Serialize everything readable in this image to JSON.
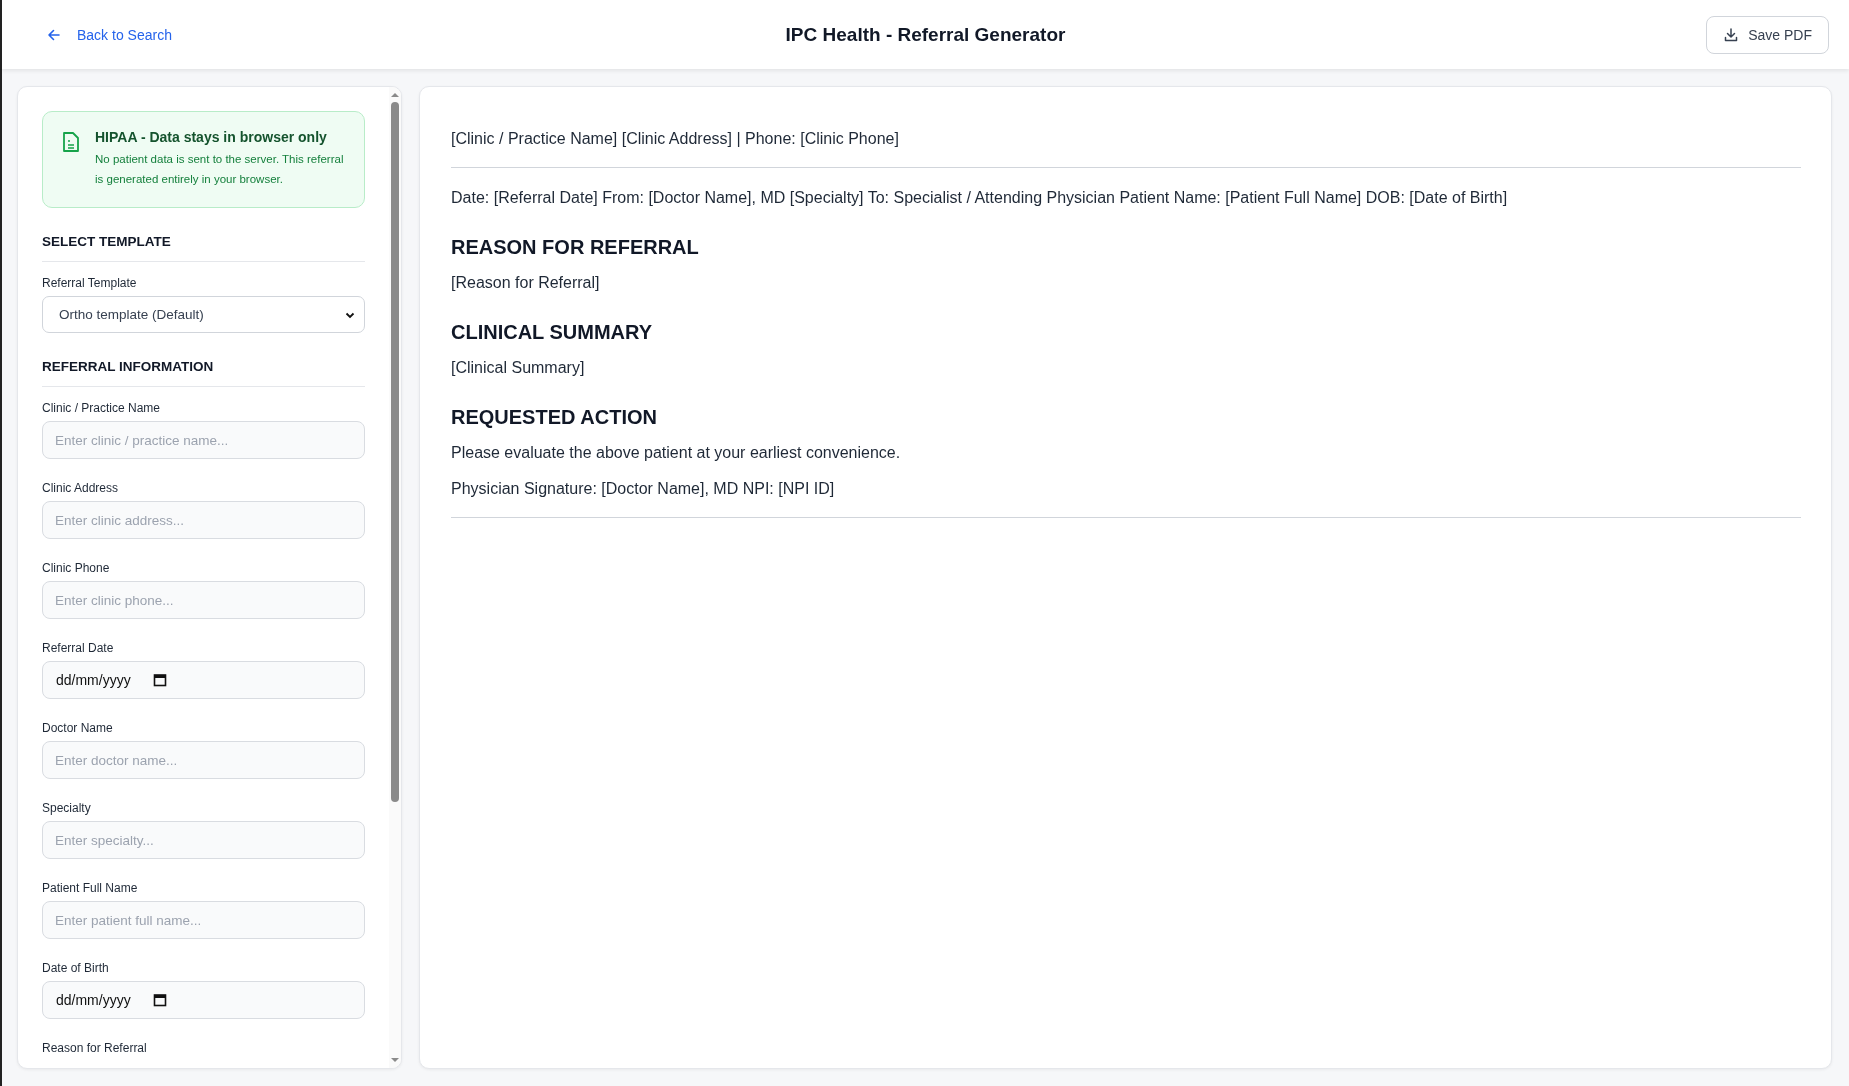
{
  "header": {
    "back_link": "Back to Search",
    "title": "IPC Health - Referral Generator",
    "save_button": "Save PDF"
  },
  "notice": {
    "title": "HIPAA - Data stays in browser only",
    "text": "No patient data is sent to the server. This referral is generated entirely in your browser."
  },
  "sections": [
    {
      "heading": "SELECT TEMPLATE",
      "fields": [
        {
          "kind": "select",
          "label": "Referral Template",
          "value": "Ortho template (Default)"
        }
      ]
    },
    {
      "heading": "REFERRAL INFORMATION",
      "fields": [
        {
          "kind": "text",
          "label": "Clinic / Practice Name",
          "placeholder": "Enter clinic / practice name..."
        },
        {
          "kind": "text",
          "label": "Clinic Address",
          "placeholder": "Enter clinic address..."
        },
        {
          "kind": "text",
          "label": "Clinic Phone",
          "placeholder": "Enter clinic phone..."
        },
        {
          "kind": "date",
          "label": "Referral Date",
          "value": "dd/mm/yyyy"
        },
        {
          "kind": "text",
          "label": "Doctor Name",
          "placeholder": "Enter doctor name..."
        },
        {
          "kind": "text",
          "label": "Specialty",
          "placeholder": "Enter specialty..."
        },
        {
          "kind": "text",
          "label": "Patient Full Name",
          "placeholder": "Enter patient full name..."
        },
        {
          "kind": "date",
          "label": "Date of Birth",
          "value": "dd/mm/yyyy"
        },
        {
          "kind": "label",
          "label": "Reason for Referral"
        }
      ]
    }
  ],
  "document": {
    "blocks": [
      {
        "kind": "paragraph",
        "text": "[Clinic / Practice Name] [Clinic Address] | Phone: [Clinic Phone]"
      },
      {
        "kind": "rule"
      },
      {
        "kind": "paragraph",
        "text": "Date: [Referral Date] From: [Doctor Name], MD [Specialty] To: Specialist / Attending Physician Patient Name: [Patient Full Name] DOB: [Date of Birth]"
      },
      {
        "kind": "heading",
        "text": "REASON FOR REFERRAL"
      },
      {
        "kind": "paragraph",
        "text": "[Reason for Referral]"
      },
      {
        "kind": "heading",
        "text": "CLINICAL SUMMARY"
      },
      {
        "kind": "paragraph",
        "text": "[Clinical Summary]"
      },
      {
        "kind": "heading",
        "text": "REQUESTED ACTION"
      },
      {
        "kind": "paragraph",
        "text": "Please evaluate the above patient at your earliest convenience."
      },
      {
        "kind": "paragraph",
        "text": "Physician Signature: [Doctor Name], MD NPI: [NPI ID]"
      },
      {
        "kind": "rule"
      }
    ]
  }
}
